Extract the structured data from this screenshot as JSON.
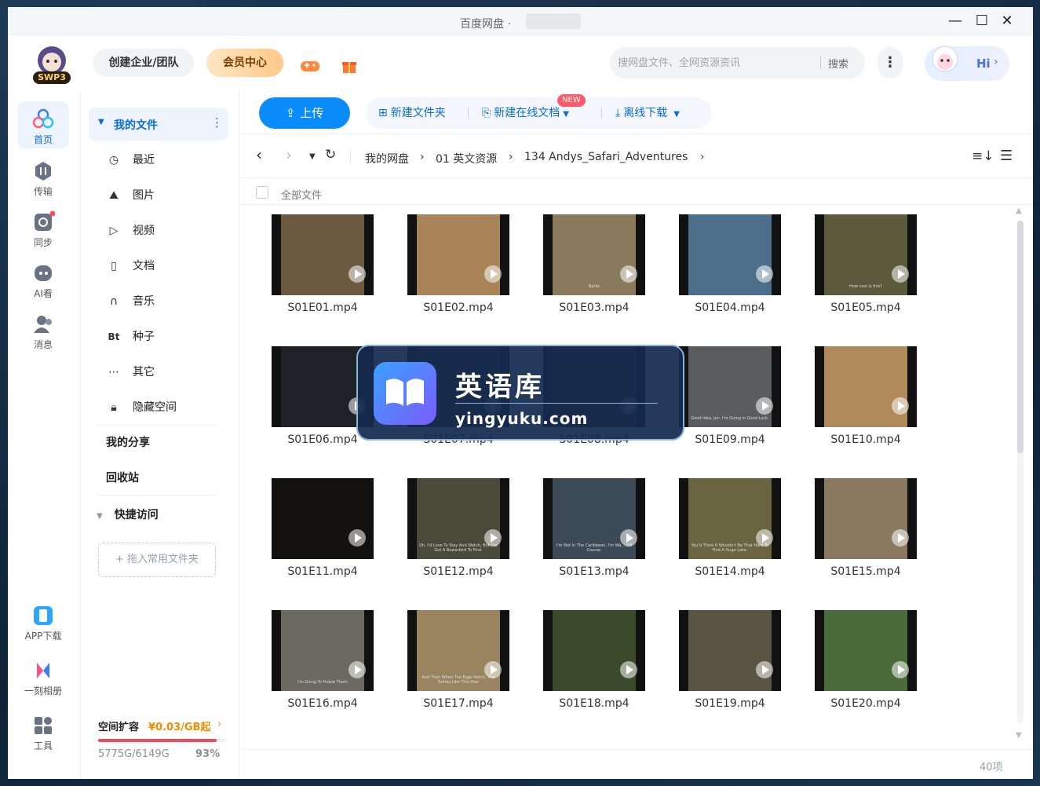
{
  "window": {
    "title": "百度网盘 ·"
  },
  "topbar": {
    "create_team": "创建企业/团队",
    "vip_center": "会员中心",
    "search_placeholder": "搜网盘文件、全网资源资讯",
    "search_button": "搜索",
    "greeting": "Hi",
    "logo_text": "SWP3"
  },
  "rail": [
    {
      "label": "首页",
      "icon": "clover-icon"
    },
    {
      "label": "传输",
      "icon": "transfer-icon"
    },
    {
      "label": "同步",
      "icon": "sync-icon"
    },
    {
      "label": "AI看",
      "icon": "ai-icon"
    },
    {
      "label": "消息",
      "icon": "message-icon"
    },
    {
      "label": "APP下载",
      "icon": "phone-icon"
    },
    {
      "label": "一刻相册",
      "icon": "album-icon"
    },
    {
      "label": "工具",
      "icon": "tools-icon"
    }
  ],
  "nav": {
    "my_files": "我的文件",
    "items": [
      {
        "label": "最近",
        "icon": "clock-icon"
      },
      {
        "label": "图片",
        "icon": "image-icon"
      },
      {
        "label": "视频",
        "icon": "video-icon"
      },
      {
        "label": "文档",
        "icon": "doc-icon"
      },
      {
        "label": "音乐",
        "icon": "headphones-icon"
      },
      {
        "label": "种子",
        "icon": "bt-icon"
      },
      {
        "label": "其它",
        "icon": "more-icon"
      },
      {
        "label": "隐藏空间",
        "icon": "lock-icon"
      }
    ],
    "bt_glyph": "Bt",
    "my_share": "我的分享",
    "recycle": "回收站",
    "quick_access": "快捷访问",
    "drop_hint": "+ 拖入常用文件夹",
    "expand_label": "空间扩容",
    "expand_price": "¥0.03/GB起",
    "storage_text": "5775G/6149G",
    "storage_percent": "93%",
    "storage_fraction": 0.93
  },
  "toolbar": {
    "upload": "上传",
    "new_folder": "新建文件夹",
    "new_doc": "新建在线文档",
    "new_badge": "NEW",
    "offline": "离线下载"
  },
  "breadcrumb": [
    "我的网盘",
    "01 英文资源",
    "134 Andys_Safari_Adventures"
  ],
  "list_header": "全部文件",
  "files": [
    {
      "name": "S01E01.mp4",
      "tone": "#6b5a40",
      "caption": ""
    },
    {
      "name": "S01E02.mp4",
      "tone": "#a88458",
      "caption": ""
    },
    {
      "name": "S01E03.mp4",
      "tone": "#8a7a5c",
      "caption": "Barks"
    },
    {
      "name": "S01E04.mp4",
      "tone": "#4d6f8c",
      "caption": ""
    },
    {
      "name": "S01E05.mp4",
      "tone": "#5b5a3c",
      "caption": "How cool is this?"
    },
    {
      "name": "S01E06.mp4",
      "tone": "#1e2226",
      "caption": ""
    },
    {
      "name": "S01E07.mp4",
      "tone": "#3a3a30",
      "caption": ""
    },
    {
      "name": "S01E08.mp4",
      "tone": "#4a4030",
      "caption": ""
    },
    {
      "name": "S01E09.mp4",
      "tone": "#5a5c60",
      "caption": "Good Idea, Jen. I'm Going In Good Luck."
    },
    {
      "name": "S01E10.mp4",
      "tone": "#b08a5a",
      "caption": ""
    },
    {
      "name": "S01E11.mp4",
      "tone": "#14120e",
      "caption": ""
    },
    {
      "name": "S01E12.mp4",
      "tone": "#4a4a3a",
      "caption": "Oh, I'd Love To Stay And Watch, But I've Got A Bowerbird To Find."
    },
    {
      "name": "S01E13.mp4",
      "tone": "#3c4a58",
      "caption": "I'm Not In The Caribbean, I'm Wa... Off Course."
    },
    {
      "name": "S01E14.mp4",
      "tone": "#6a6440",
      "caption": "You'd Think It Wouldn't Be That Hard To Find A Huge Lake."
    },
    {
      "name": "S01E15.mp4",
      "tone": "#8a7860",
      "caption": ""
    },
    {
      "name": "S01E16.mp4",
      "tone": "#6a6a60",
      "caption": "I'm Going To Follow Them"
    },
    {
      "name": "S01E17.mp4",
      "tone": "#9a8460",
      "caption": "And Then When The Eggs Hatch, The Turtles Like This Own"
    },
    {
      "name": "S01E18.mp4",
      "tone": "#3a4a2a",
      "caption": ""
    },
    {
      "name": "S01E19.mp4",
      "tone": "#5a5444",
      "caption": ""
    },
    {
      "name": "S01E20.mp4",
      "tone": "#4a6a3a",
      "caption": ""
    }
  ],
  "status": {
    "count": "40项"
  },
  "watermark": {
    "title": "英语库",
    "url": "yingyuku.com"
  },
  "colors": {
    "accent": "#0a8cfb",
    "vip": "#ffd9a8",
    "storage_bar": "#ee4b5c",
    "price": "#f08c00"
  }
}
